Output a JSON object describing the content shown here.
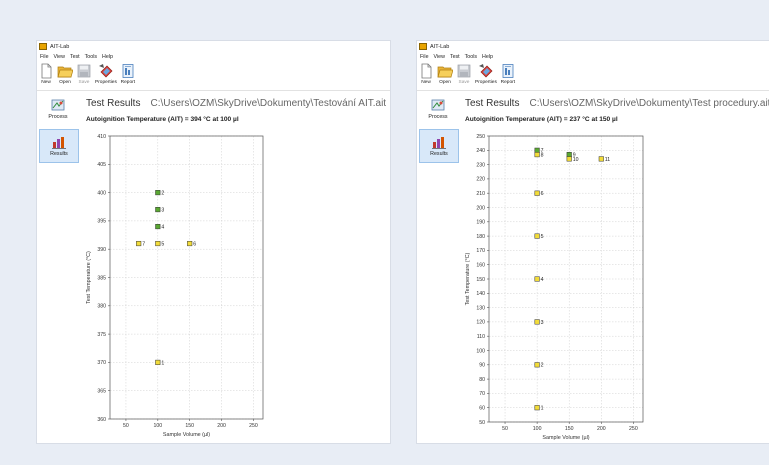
{
  "windows": [
    {
      "app_title": "AIT-Lab",
      "menu": [
        "File",
        "View",
        "Test",
        "Tools",
        "Help"
      ],
      "toolbar": [
        "New",
        "Open",
        "Save",
        "Properties",
        "Report"
      ],
      "sidebar": [
        "Process",
        "Results"
      ],
      "results_heading": "Test Results",
      "file_path": "C:\\Users\\OZM\\SkyDrive\\Dokumenty\\Testování AIT.ait",
      "ait_result": "Autoignition Temperature (AIT) = 394 °C at 100 µl"
    },
    {
      "app_title": "AIT-Lab",
      "menu": [
        "File",
        "View",
        "Test",
        "Tools",
        "Help"
      ],
      "toolbar": [
        "New",
        "Open",
        "Save",
        "Properties",
        "Report"
      ],
      "sidebar": [
        "Process",
        "Results"
      ],
      "results_heading": "Test Results",
      "file_path": "C:\\Users\\OZM\\SkyDrive\\Dokumenty\\Test procedury.ait",
      "ait_result": "Autoignition Temperature (AIT) = 237 °C at 150 µl"
    }
  ],
  "colors": {
    "ignition": "#5aa832",
    "no_ignition": "#f2dc3a",
    "background": "#e8edf5",
    "active_side": "#d8e8f9"
  },
  "icons": [
    "app-icon",
    "new-icon",
    "open-folder-icon",
    "save-icon",
    "properties-icon",
    "report-icon",
    "process-icon",
    "results-icon"
  ],
  "chart_data": [
    {
      "type": "scatter",
      "xlabel": "Sample Volume (µl)",
      "ylabel": "Test Temperature (°C)",
      "xlim": [
        25,
        265
      ],
      "ylim": [
        360,
        410
      ],
      "xticks": [
        50,
        100,
        150,
        200,
        250
      ],
      "yticks": [
        360,
        365,
        370,
        375,
        380,
        385,
        390,
        395,
        400,
        405,
        410
      ],
      "grid": true,
      "points": [
        {
          "x": 100,
          "y": 370,
          "label": "1",
          "ignition": false
        },
        {
          "x": 100,
          "y": 400,
          "label": "2",
          "ignition": true
        },
        {
          "x": 100,
          "y": 397,
          "label": "3",
          "ignition": true
        },
        {
          "x": 100,
          "y": 394,
          "label": "4",
          "ignition": true
        },
        {
          "x": 100,
          "y": 391,
          "label": "5",
          "ignition": false
        },
        {
          "x": 150,
          "y": 391,
          "label": "6",
          "ignition": false
        },
        {
          "x": 70,
          "y": 391,
          "label": "7",
          "ignition": false
        }
      ]
    },
    {
      "type": "scatter",
      "xlabel": "Sample Volume (µl)",
      "ylabel": "Test Temperature (°C)",
      "xlim": [
        25,
        265
      ],
      "ylim": [
        50,
        250
      ],
      "xticks": [
        50,
        100,
        150,
        200,
        250
      ],
      "yticks": [
        50,
        60,
        70,
        80,
        90,
        100,
        110,
        120,
        130,
        140,
        150,
        160,
        170,
        180,
        190,
        200,
        210,
        220,
        230,
        240,
        250
      ],
      "grid": true,
      "points": [
        {
          "x": 100,
          "y": 60,
          "label": "1",
          "ignition": false
        },
        {
          "x": 100,
          "y": 90,
          "label": "2",
          "ignition": false
        },
        {
          "x": 100,
          "y": 120,
          "label": "3",
          "ignition": false
        },
        {
          "x": 100,
          "y": 150,
          "label": "4",
          "ignition": false
        },
        {
          "x": 100,
          "y": 180,
          "label": "5",
          "ignition": false
        },
        {
          "x": 100,
          "y": 210,
          "label": "6",
          "ignition": false
        },
        {
          "x": 100,
          "y": 240,
          "label": "7",
          "ignition": true
        },
        {
          "x": 100,
          "y": 237,
          "label": "8",
          "ignition": false
        },
        {
          "x": 150,
          "y": 237,
          "label": "9",
          "ignition": true
        },
        {
          "x": 150,
          "y": 234,
          "label": "10",
          "ignition": false
        },
        {
          "x": 200,
          "y": 234,
          "label": "11",
          "ignition": false
        }
      ]
    }
  ]
}
